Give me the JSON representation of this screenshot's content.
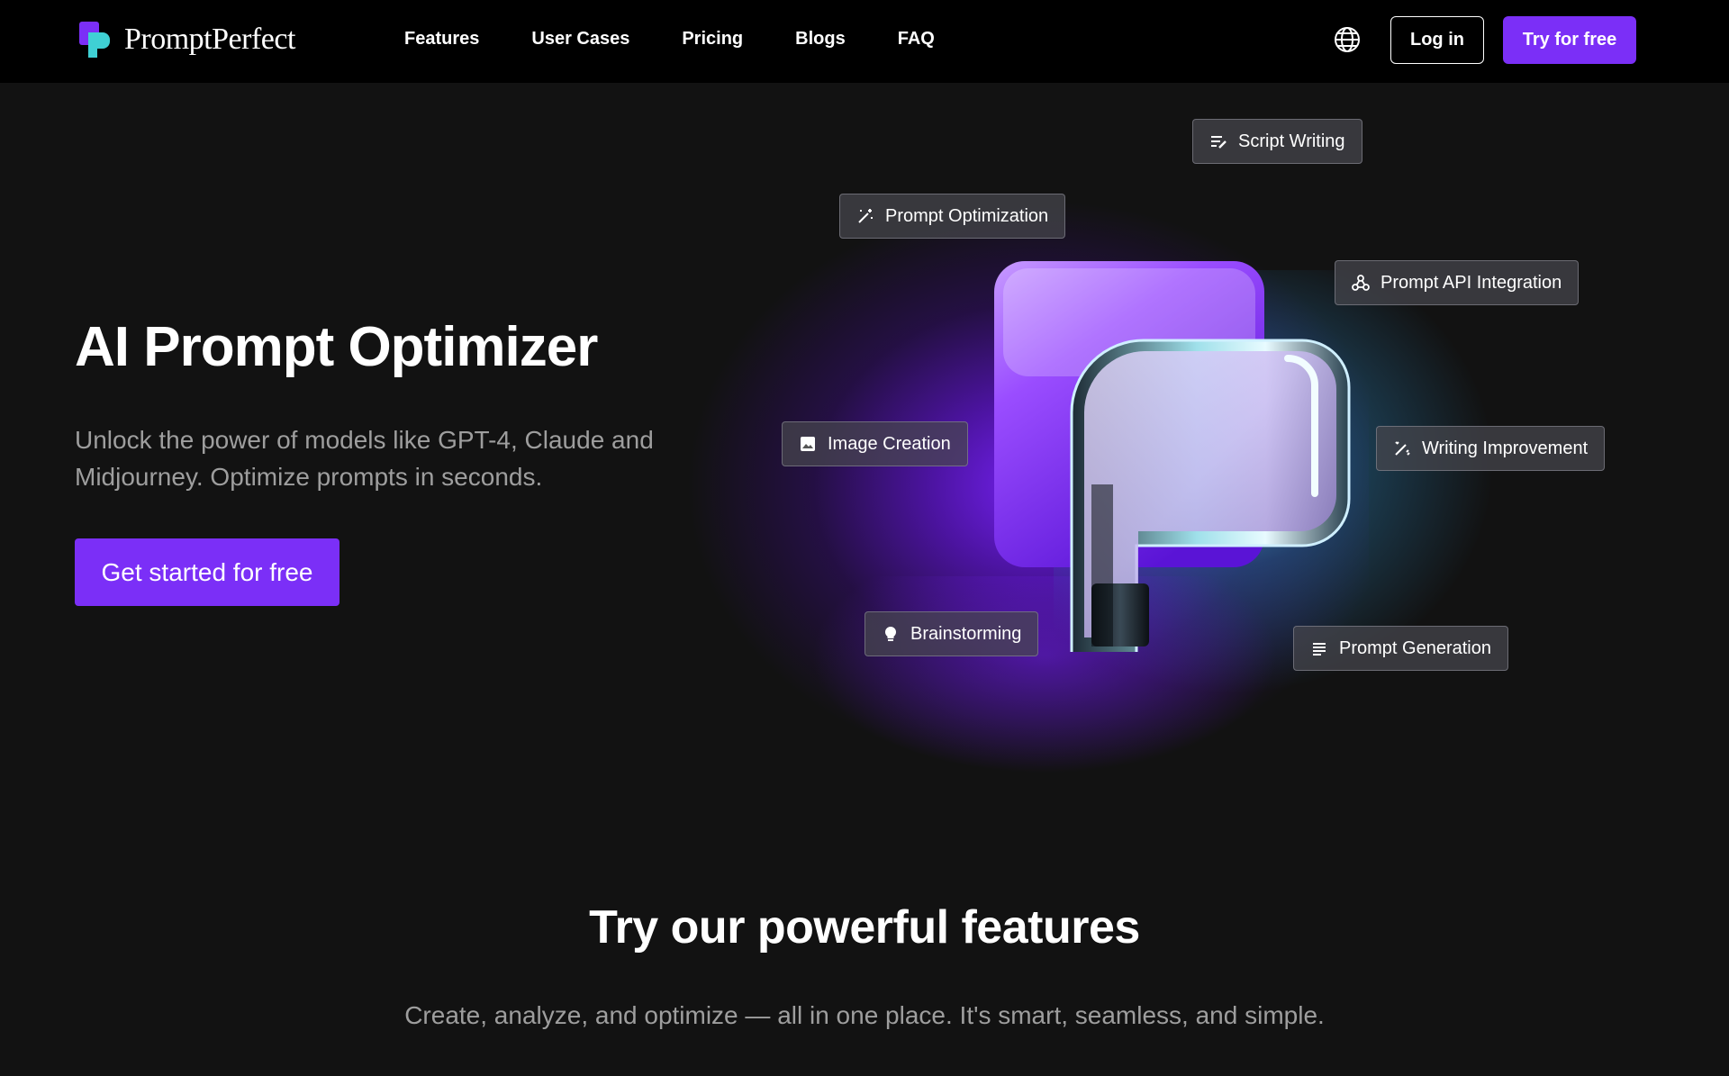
{
  "nav": {
    "logo_text": "PromptPerfect",
    "links": [
      "Features",
      "User Cases",
      "Pricing",
      "Blogs",
      "FAQ"
    ],
    "login_label": "Log in",
    "try_label": "Try for free"
  },
  "hero": {
    "title": "AI Prompt Optimizer",
    "subtitle": "Unlock the power of models like GPT-4, Claude and Midjourney. Optimize prompts in seconds.",
    "cta_label": "Get started for free"
  },
  "chips": {
    "script_writing": "Script Writing",
    "prompt_optimization": "Prompt Optimization",
    "api_integration": "Prompt API Integration",
    "image_creation": "Image Creation",
    "writing_improvement": "Writing Improvement",
    "brainstorming": "Brainstorming",
    "prompt_generation": "Prompt Generation"
  },
  "features_section": {
    "title": "Try our powerful features",
    "subtitle": "Create, analyze, and optimize — all in one place. It's smart, seamless, and simple."
  },
  "colors": {
    "accent": "#7b2ff7",
    "background": "#121212",
    "nav_background": "#000000",
    "muted_text": "#9e9e9e"
  }
}
